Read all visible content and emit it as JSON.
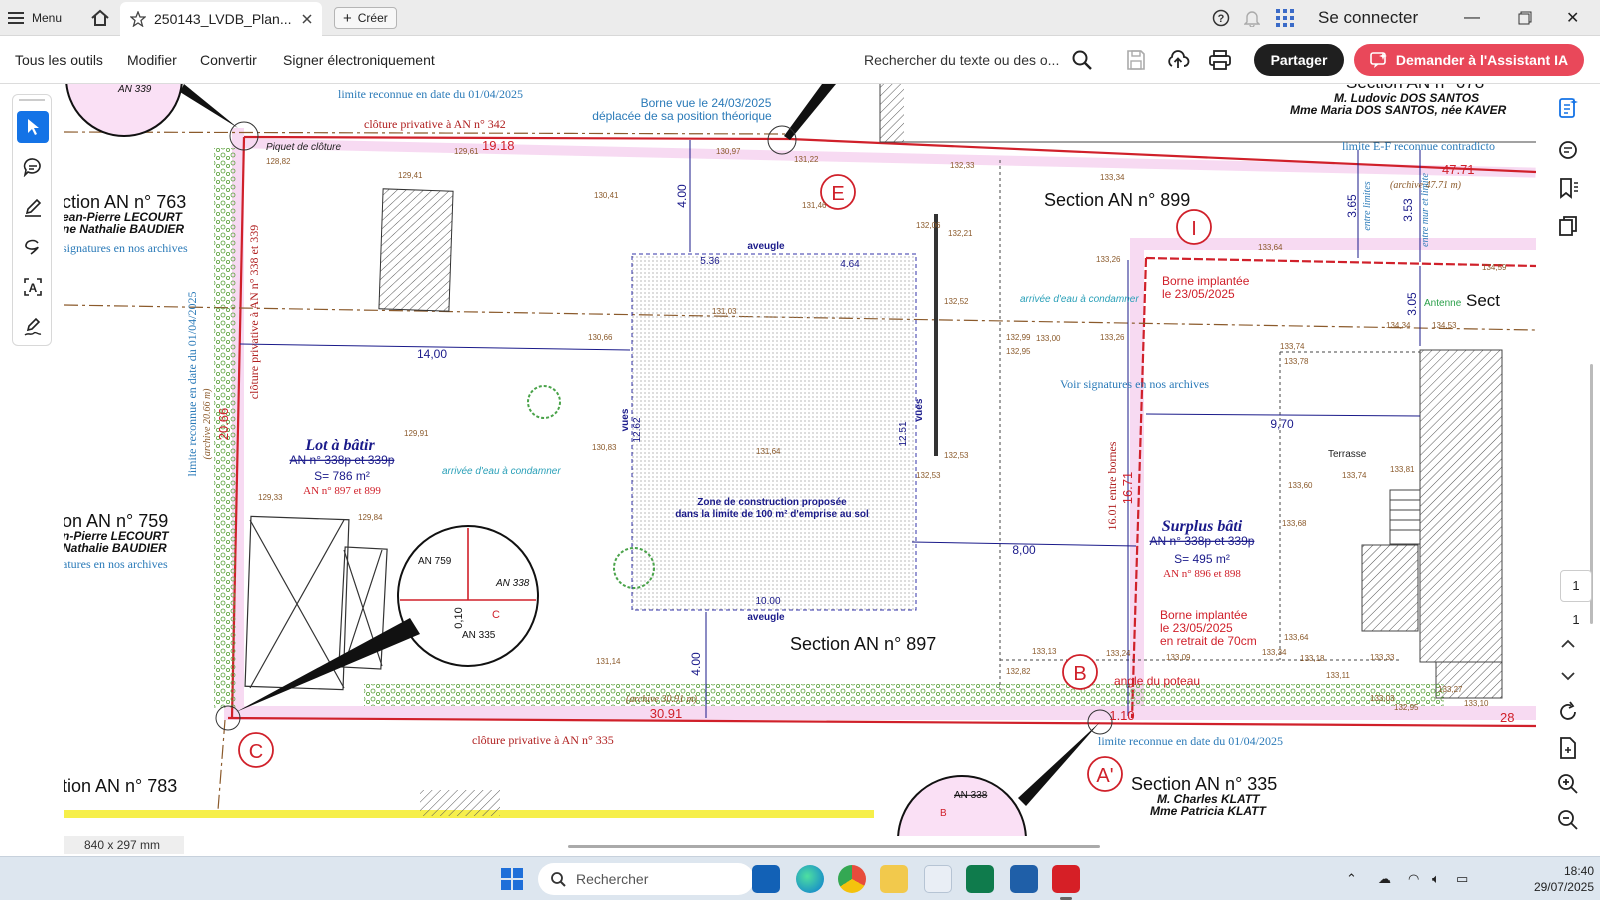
{
  "tabbar": {
    "menu_label": "Menu",
    "tab_title": "250143_LVDB_Plan...",
    "create_label": "Créer",
    "signin_label": "Se connecter"
  },
  "toolbar": {
    "menus": [
      "Tous les outils",
      "Modifier",
      "Convertir",
      "Signer électroniquement"
    ],
    "search_text": "Rechercher du texte ou des o...",
    "share_label": "Partager",
    "ai_label": "Demander à l'Assistant IA",
    "ai_color": "#e9485a"
  },
  "pager": {
    "current": "1",
    "total": "1"
  },
  "page_size": "840 x 297 mm",
  "taskbar": {
    "search_placeholder": "Rechercher",
    "time": "18:40",
    "date": "29/07/2025"
  },
  "plan": {
    "top_notes": {
      "limit_top": "limite reconnue en date du 01/04/2025",
      "cloture_342": "clôture privative à AN n° 342",
      "borne_vue": "Borne vue le 24/03/2025",
      "borne_deplacee": "déplacée de sa position théorique",
      "dim_top": "19.18",
      "piquet": "Piquet de clôture"
    },
    "section_678": {
      "title": "Section AN n° 678",
      "owner1": "M. Ludovic DOS SANTOS",
      "owner2": "Mme Maria DOS SANTOS, née KAVER"
    },
    "limite_ef": "limite E-F reconnue contradicto",
    "dim_4771": "47.71",
    "archive_4771": "(archive 47.71 m)",
    "section_763": {
      "title": "ction AN n° 763",
      "owner1": "ean-Pierre LECOURT",
      "owner2": "ne Nathalie BAUDIER",
      "note": "signatures en nos archives"
    },
    "section_759": {
      "title": "on AN n° 759",
      "owner1": "n-Pierre LECOURT",
      "owner2": "Nathalie BAUDIER",
      "note": "atures en nos archives"
    },
    "section_783": "tion AN n° 783",
    "section_899": "Section AN n° 899",
    "section_897": "Section AN n° 897",
    "section_335": {
      "title": "Section AN n° 335",
      "owner1": "M. Charles KLATT",
      "owner2": "Mme Patricia KLATT"
    },
    "sect_right": "Sect",
    "lot": {
      "title": "Lot à bâtir",
      "ref": "AN n° 338p et 339p",
      "surface": "S= 786 m²",
      "new_ref": "AN n° 897 et 899"
    },
    "surplus": {
      "title": "Surplus bâti",
      "ref": "AN n° 338p et 339p",
      "surface": "S= 495 m²",
      "new_ref": "AN n° 896 et 898"
    },
    "zone": {
      "line1": "Zone de construction proposée",
      "line2": "dans la limite de 100 m² d'emprise au sol"
    },
    "borne_implantee_1": [
      "Borne implantée",
      "le 23/05/2025"
    ],
    "borne_implantee_2": [
      "Borne implantée",
      "le 23/05/2025",
      "en retrait de 70cm"
    ],
    "angle_poteau": "angle du poteau",
    "arrivee_eau": "arrivée d'eau à condamner",
    "voir_signatures": "Voir signatures en nos archives",
    "terrasse": "Terrasse",
    "antenne": "Antenne",
    "aveugle": "aveugle",
    "vues": "vues",
    "limit_left": "limite reconnue en date du 01/04/2025",
    "archive_left": "(archive 20.66 m)",
    "cloture_338": "clôture privative à AN n° 338 et 339",
    "cloture_335": "clôture privative à AN n° 335",
    "limit_bottom": "limite reconnue en date du 01/04/2025",
    "entre_bornes": "16.01 entre bornes",
    "entre_limites": "entre limites",
    "entre_mur": "entre mur et limite",
    "archive_3091": "(archive 30.91 m)",
    "dims": {
      "d2066": "20.66",
      "d1400": "14,00",
      "d400a": "4.00",
      "d400b": "4.00",
      "d536": "5.36",
      "d464": "4.64",
      "d1262": "12.62",
      "d1251": "12.51",
      "d1000": "10.00",
      "d800": "8,00",
      "d1671": "16.71",
      "d970": "9,70",
      "d365": "3.65",
      "d353": "3.53",
      "d305": "3.05",
      "d3091": "30.91",
      "d110": "1.10",
      "d010": "0,10",
      "d28": "28"
    },
    "points": {
      "E": "E",
      "I": "I",
      "B": "B",
      "C": "C",
      "A": "A'"
    },
    "detail": {
      "an759": "AN 759",
      "an338": "AN 338",
      "an335": "AN 335",
      "c": "C",
      "an338b": "AN 338",
      "b": "B",
      "an339": "AN 339"
    },
    "spot_heights": [
      "128,82",
      "129,61",
      "130,97",
      "131,22",
      "129,41",
      "130,41",
      "131,46",
      "132,33",
      "133,34",
      "132,06",
      "132,21",
      "133,26",
      "133,64",
      "134,59",
      "130,66",
      "131,03",
      "132,52",
      "132,99",
      "133,00",
      "133,26",
      "132,95",
      "134,34",
      "134,53",
      "133,74",
      "133,78",
      "129,91",
      "130,83",
      "131,64",
      "132,53",
      "132,53",
      "129,33",
      "129,84",
      "131,14",
      "133,13",
      "133,24",
      "133,09",
      "133,64",
      "133,34",
      "133,18",
      "133,33",
      "133,11",
      "133,03",
      "133,81",
      "133,74",
      "133,68",
      "133,60",
      "132,82",
      "132,95",
      "133,10",
      "133,27"
    ]
  }
}
